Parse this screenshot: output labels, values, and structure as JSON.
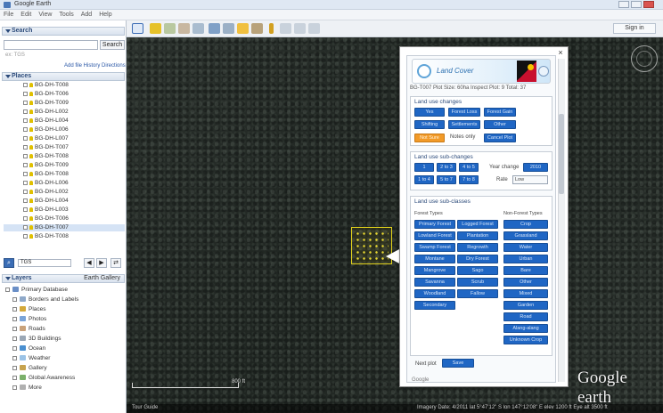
{
  "window": {
    "title": "Google Earth",
    "menu": [
      "File",
      "Edit",
      "View",
      "Tools",
      "Add",
      "Help"
    ]
  },
  "toolbar": {
    "icons": [
      "hide-sidebar-icon",
      "placemark-icon",
      "polygon-icon",
      "path-icon",
      "overlay-icon",
      "record-tour-icon",
      "historical-imagery-icon",
      "sun-icon",
      "planets-icon",
      "ruler-icon",
      "email-icon",
      "print-icon",
      "view-in-maps-icon"
    ],
    "sign_in_label": "Sign in"
  },
  "search": {
    "header": "Search",
    "button_label": "Search",
    "hint": "ex: TGS",
    "links": "Add file  History  Directions"
  },
  "places": {
    "header": "Places",
    "items": [
      "BG-DH-T008",
      "BG-DH-T006",
      "BG-DH-T009",
      "BG-DH-L002",
      "BG-DH-L004",
      "BG-DH-L006",
      "BG-DH-L007",
      "BG-DH-T007",
      "BG-DH-T008",
      "BG-DH-T009",
      "BG-DH-T008",
      "BG-DH-L006",
      "BG-DH-L002",
      "BG-DH-L004",
      "BG-DH-L003",
      "BG-DH-T006",
      "BG-DH-T007",
      "BG-DH-T008"
    ],
    "selected_index": 16,
    "footer_label": "TGS"
  },
  "layers": {
    "header": "Layers",
    "gallery_label": "Earth Gallery",
    "items": [
      "Primary Database",
      "Borders and Labels",
      "Places",
      "Photos",
      "Roads",
      "3D Buildings",
      "Ocean",
      "Weather",
      "Gallery",
      "Global Awareness",
      "More"
    ]
  },
  "map": {
    "brand": "Google earth",
    "scale_label": "800 ft",
    "status_left": "Tour Guide",
    "status_right": "Imagery Date: 4/2011   lat  5°47'12\" S   lon 147°12'08\" E   elev  1200 ft   Eye alt  3500 ft"
  },
  "balloon": {
    "close_label": "×",
    "logo_text": "Land Cover",
    "info_line": "BG-T007  Plot Size: 60ha   Inspect Plot: 9   Total: 37",
    "section1": {
      "title": "Land use changes",
      "buttons": [
        "Yes",
        "Forest Loss",
        "Forest Gain",
        "Shifting",
        "Settlements",
        "Other"
      ],
      "orange_label": "Not Sure",
      "text_label": "Notes only",
      "last_button": "Cancel Plot"
    },
    "section2": {
      "title": "Land use sub-changes",
      "buttons": [
        "1",
        "2 to 3",
        "4 to 5",
        "1 to 4",
        "5 to 7",
        "7 to 8"
      ],
      "year_label": "Year change",
      "year_value": "2010",
      "rate_label": "Rate",
      "rate_value": "Low"
    },
    "section3": {
      "title": "Land use sub-classes",
      "col1_head": "Forest Types",
      "col3_head": "Non-Forest Types",
      "left_buttons": [
        "Primary Forest",
        "Lowland Forest",
        "Swamp Forest",
        "Montane",
        "Mangrove",
        "Savanna",
        "Woodland",
        "Secondary"
      ],
      "mid_buttons": [
        "Logged Forest",
        "Plantation",
        "Regrowth",
        "Dry Forest",
        "Sago",
        "Scrub",
        "Fallow"
      ],
      "right_buttons": [
        "Crop",
        "Grassland",
        "Water",
        "Urban",
        "Bare",
        "Other",
        "Mixed",
        "Garden",
        "Road",
        "Alang-alang",
        "Unknown Crop"
      ],
      "bottom_label": "Next plot",
      "bottom_button": "Save"
    },
    "footer_label": "Google"
  }
}
